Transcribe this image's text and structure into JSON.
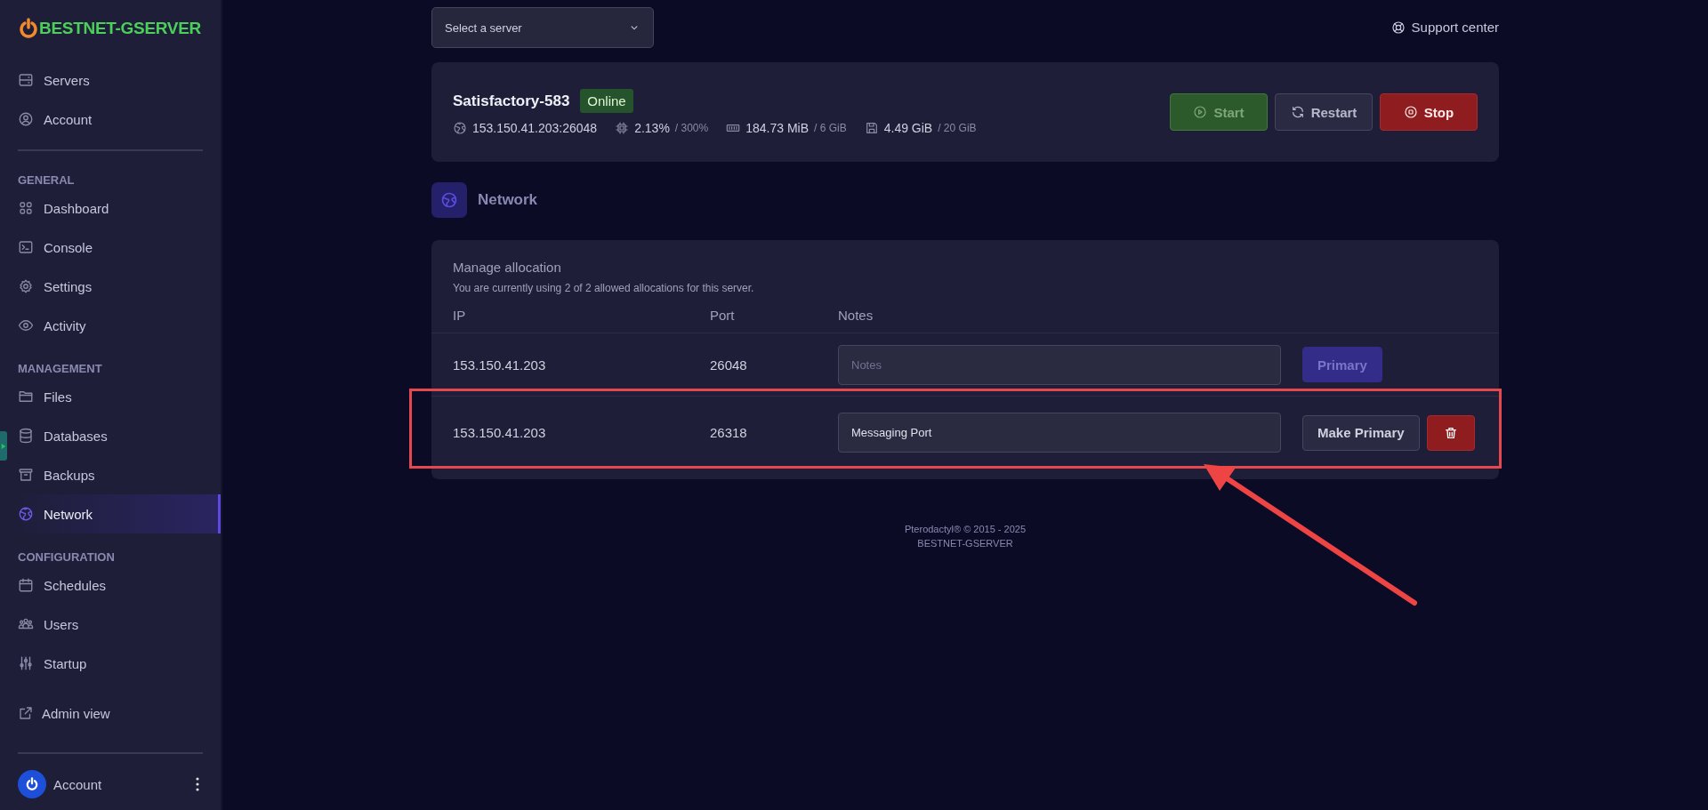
{
  "sidebar": {
    "logo": "BESTNET-GSERVER",
    "top_items": [
      {
        "label": "Servers",
        "selected": false
      },
      {
        "label": "Account",
        "selected": false
      }
    ],
    "sections": [
      {
        "heading": "GENERAL",
        "items": [
          {
            "label": "Dashboard",
            "selected": false
          },
          {
            "label": "Console",
            "selected": false
          },
          {
            "label": "Settings",
            "selected": false
          },
          {
            "label": "Activity",
            "selected": false
          }
        ]
      },
      {
        "heading": "MANAGEMENT",
        "items": [
          {
            "label": "Files",
            "selected": false
          },
          {
            "label": "Databases",
            "selected": false
          },
          {
            "label": "Backups",
            "selected": false
          },
          {
            "label": "Network",
            "selected": true
          }
        ]
      },
      {
        "heading": "CONFIGURATION",
        "items": [
          {
            "label": "Schedules",
            "selected": false
          },
          {
            "label": "Users",
            "selected": false
          },
          {
            "label": "Startup",
            "selected": false
          }
        ]
      }
    ],
    "admin_link": "Admin view",
    "account": {
      "label": "Account"
    }
  },
  "topbar": {
    "server_select": {
      "placeholder": "Select a server"
    },
    "support_link": "Support center"
  },
  "server": {
    "name": "Satisfactory-583",
    "status": "Online",
    "stats": [
      {
        "value": "153.150.41.203:26048"
      },
      {
        "value": "2.13%",
        "limit": "/ 300%"
      },
      {
        "value": "184.73 MiB",
        "limit": "/ 6 GiB"
      },
      {
        "value": "4.49 GiB",
        "limit": "/ 20 GiB"
      }
    ],
    "buttons": [
      {
        "label": "Start",
        "kind": "start"
      },
      {
        "label": "Restart",
        "kind": "restart"
      },
      {
        "label": "Stop",
        "kind": "stop"
      }
    ]
  },
  "page": {
    "title": "Network"
  },
  "allocations": {
    "title": "Manage allocation",
    "subtitle": "You are currently using 2 of 2 allowed allocations for this server.",
    "columns": [
      "IP",
      "Port",
      "Notes"
    ],
    "rows": [
      {
        "ip": "153.150.41.203",
        "port": "26048",
        "notes": {
          "placeholder": "Notes"
        },
        "button": "Primary",
        "primary": true,
        "deletable": false,
        "highlighted": false
      },
      {
        "ip": "153.150.41.203",
        "port": "26318",
        "notes": {
          "value": "Messaging Port"
        },
        "button": "Make Primary",
        "primary": false,
        "deletable": true,
        "highlighted": true
      }
    ]
  },
  "footer": {
    "lines": [
      "Pterodactyl® © 2015 - 2025",
      "BESTNET-GSERVER"
    ]
  }
}
